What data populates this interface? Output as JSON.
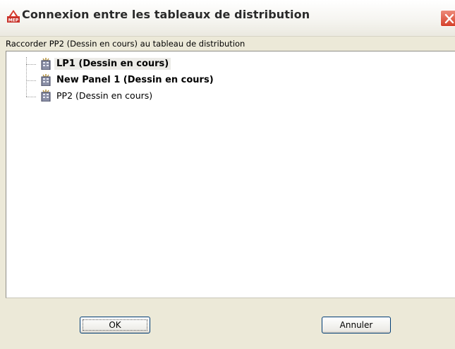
{
  "window": {
    "title": "Connexion entre les tableaux de distribution",
    "app_icon": "autocad-mep-icon",
    "close_icon": "close-icon"
  },
  "instruction": "Raccorder PP2 (Dessin en cours) au tableau de distribution",
  "tree": {
    "nodes": [
      {
        "label": "LP1 (Dessin en cours)",
        "bold": true,
        "selected": true,
        "icon": "electrical-panel-icon"
      },
      {
        "label": "New Panel 1 (Dessin en cours)",
        "bold": true,
        "selected": false,
        "icon": "electrical-panel-icon"
      },
      {
        "label": "PP2 (Dessin en cours)",
        "bold": false,
        "selected": false,
        "icon": "electrical-panel-icon"
      }
    ]
  },
  "buttons": {
    "ok": "OK",
    "cancel": "Annuler"
  },
  "colors": {
    "dialog_bg": "#ece9d8",
    "close_red": "#d5412b",
    "button_border": "#003c74"
  }
}
